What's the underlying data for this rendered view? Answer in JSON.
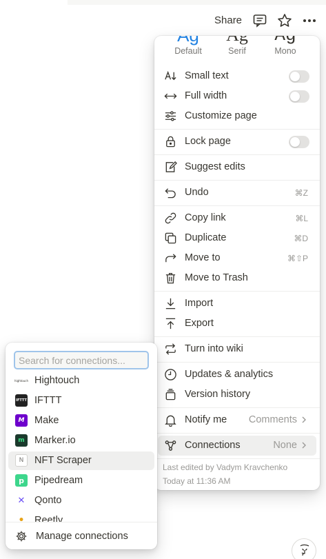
{
  "topbar": {
    "share_label": "Share",
    "icons": [
      "comment-icon",
      "star-icon",
      "more-icon"
    ]
  },
  "menu": {
    "fonts": [
      {
        "sample": "Ag",
        "label": "Default",
        "active": true,
        "color": "#2383e2"
      },
      {
        "sample": "Ag",
        "label": "Serif",
        "active": false
      },
      {
        "sample": "Ag",
        "label": "Mono",
        "active": false
      }
    ],
    "items": {
      "small_text": "Small text",
      "full_width": "Full width",
      "customize_page": "Customize page",
      "lock_page": "Lock page",
      "suggest_edits": "Suggest edits",
      "undo": "Undo",
      "undo_shortcut": "⌘Z",
      "copy_link": "Copy link",
      "copy_link_shortcut": "⌘L",
      "duplicate": "Duplicate",
      "duplicate_shortcut": "⌘D",
      "move_to": "Move to",
      "move_to_shortcut": "⌘⇧P",
      "move_to_trash": "Move to Trash",
      "import": "Import",
      "export": "Export",
      "turn_into_wiki": "Turn into wiki",
      "updates_analytics": "Updates & analytics",
      "version_history": "Version history",
      "notify_me": "Notify me",
      "notify_me_value": "Comments",
      "connections": "Connections",
      "connections_value": "None"
    },
    "toggles": {
      "small_text": false,
      "full_width": false,
      "lock_page": false
    },
    "last_edited_by": "Last edited by Vadym Kravchenko",
    "last_edited_time": "Today at 11:36 AM"
  },
  "connections_popover": {
    "search_placeholder": "Search for connections...",
    "items": [
      {
        "name": "Hightouch",
        "logo": "hightouch-logo",
        "logo_text": "hightouch",
        "color": "#ffffff"
      },
      {
        "name": "IFTTT",
        "logo": "ifttt-logo",
        "logo_text": "IFTTT",
        "color": "#222222"
      },
      {
        "name": "Make",
        "logo": "make-logo",
        "logo_text": "M",
        "color": "#6d00cc"
      },
      {
        "name": "Marker.io",
        "logo": "markerio-logo",
        "logo_text": "m",
        "color": "#1b3a2d"
      },
      {
        "name": "NFT Scraper",
        "logo": "nft-scraper-logo",
        "logo_text": "N",
        "color": "#ffffff"
      },
      {
        "name": "Pipedream",
        "logo": "pipedream-logo",
        "logo_text": "p",
        "color": "#3dd68c"
      },
      {
        "name": "Qonto",
        "logo": "qonto-logo",
        "logo_text": "✕",
        "color": "#ffffff"
      },
      {
        "name": "Reetly",
        "logo": "reetly-logo",
        "logo_text": "•",
        "color": "#ffffff"
      }
    ],
    "highlighted_index": 4,
    "manage_label": "Manage connections"
  }
}
